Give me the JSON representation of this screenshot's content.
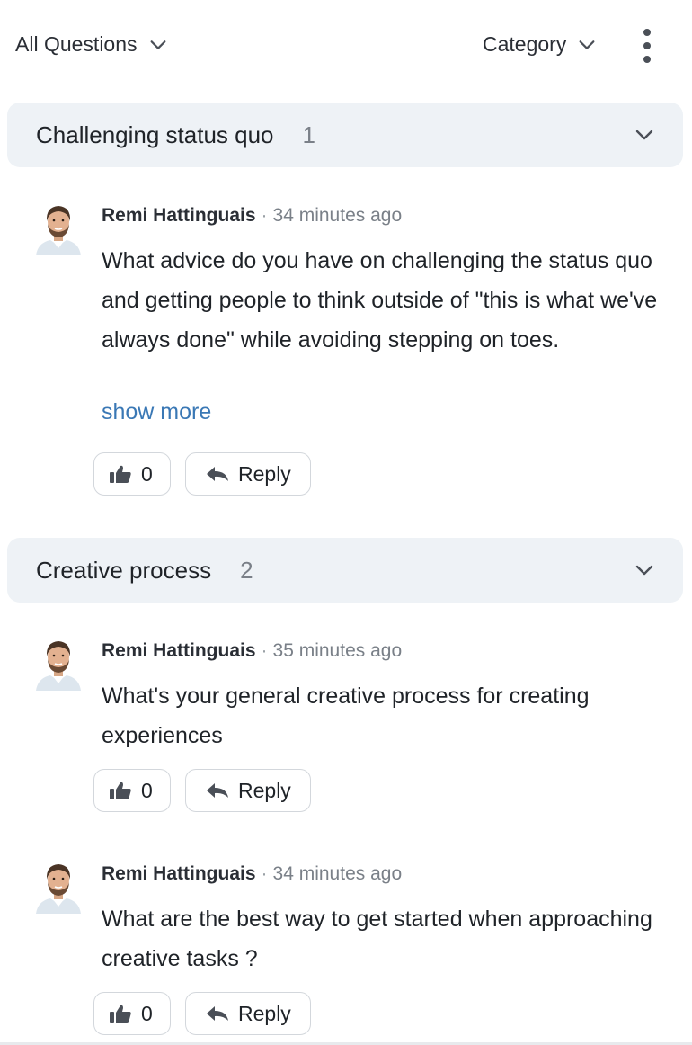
{
  "toolbar": {
    "filter_label": "All Questions",
    "category_label": "Category"
  },
  "groups": [
    {
      "title": "Challenging status quo",
      "count": "1",
      "questions": [
        {
          "author": "Remi Hattinguais",
          "time": "34 minutes ago",
          "text": "What advice do you have on challenging the status quo and getting people to think outside of \"this is what we've always done\" while avoiding stepping on toes.",
          "show_more": "show more",
          "likes": "0",
          "reply_label": "Reply"
        }
      ]
    },
    {
      "title": "Creative process",
      "count": "2",
      "questions": [
        {
          "author": "Remi Hattinguais",
          "time": "35 minutes ago",
          "text": "What's your general creative process for creating experiences",
          "likes": "0",
          "reply_label": "Reply"
        },
        {
          "author": "Remi Hattinguais",
          "time": "34 minutes ago",
          "text": "What are the best way to get started when approaching creative tasks ?",
          "likes": "0",
          "reply_label": "Reply"
        }
      ]
    }
  ],
  "separator": "·",
  "colors": {
    "header_bg": "#eef2f6",
    "link": "#3a78b5",
    "muted": "#7a8088"
  },
  "icons": {
    "filter_chevron": "chevron-down-icon",
    "menu": "more-vertical-icon",
    "like": "thumbs-up-icon",
    "reply": "reply-icon"
  }
}
